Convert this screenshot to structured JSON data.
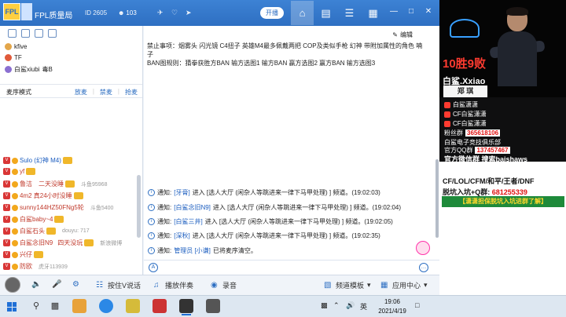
{
  "titlebar": {
    "logo_text": "FPL",
    "channel_name": "FPL质量局",
    "id_label": "ID 2605",
    "fans": "103",
    "open_label": "开播"
  },
  "left": {
    "rows": [
      {
        "name": "kfive"
      },
      {
        "name": "TF"
      },
      {
        "name": "白鲨xiubi",
        "tag": "毒B"
      }
    ],
    "queue_mode": "麦序模式",
    "queue_actions": [
      "放麦",
      "禁麦",
      "抢麦"
    ],
    "users": [
      {
        "name": "Sulo (幻神 M4)",
        "extra": ""
      },
      {
        "name": "yf",
        "extra": ""
      },
      {
        "name": "鲁洁",
        "name2": "二天没睡",
        "extra": "斗鱼95968"
      },
      {
        "name": "4m2 真24小时没睡",
        "extra": ""
      },
      {
        "name": "sunny144HZ50FNg5轮",
        "extra": "斗鱼5400"
      },
      {
        "name": "白鲨baby~4",
        "extra": ""
      },
      {
        "name": "白鲨石头",
        "extra": "douyu: 717"
      },
      {
        "name": "白鲨念旧N9",
        "name2": "四天没玩",
        "extra": "新浪微博"
      },
      {
        "name": "兴仔",
        "extra": ""
      },
      {
        "name": "防欧",
        "extra": "虎牙113939"
      }
    ]
  },
  "main": {
    "edit_label": "编辑",
    "notice": [
      "禁止事项：烟雾头 闪光镜 C4扭子 英雄M4最多佩戴两把 COP及类似手枪 幻神 带附加属性的角色 喃",
      "子",
      "BAN图规则：猜拳获胜方BAN 输方选图1 输方BAN 赢方选图2 赢方BAN 输方选图3"
    ],
    "messages": [
      {
        "prefix": "通知:",
        "channel": "[牙膏]",
        "text": " 进入 [选人大厅 (闲杂人等跳进来一律下马甲处理) ] 频道。(19:02:03)"
      },
      {
        "prefix": "通知:",
        "channel": "[白鲨念旧N9]",
        "text": " 进入 [选人大厅 (闲杂人等跳进来一律下马甲处理) ] 频道。(19:02:04)"
      },
      {
        "prefix": "通知:",
        "channel": "[白鲨三井]",
        "text": " 进入 [选人大厅 (闲杂人等跳进来一律下马甲处理) ] 频道。(19:02:05)"
      },
      {
        "prefix": "通知:",
        "channel": "[深秋]",
        "text": " 进入 [选人大厅 (闲杂人等跳进来一律下马甲处理) ] 频道。(19:02:35)"
      },
      {
        "prefix": "通知:",
        "channel": "管理员 [小谦]",
        "text": " 已将麦序清空。"
      }
    ]
  },
  "toolbar": {
    "voice_label": "按住V说话",
    "music_label": "播放伴奏",
    "record_label": "录音",
    "channel_template": "频道模板",
    "app_center": "应用中心"
  },
  "stream": {
    "score": "10胜9败",
    "player_name": "白鲨.Xxiao",
    "plate_name": "郑 琪",
    "lines": [
      {
        "label": "白鲨潇潇"
      },
      {
        "label": "CF白鲨潇潇"
      },
      {
        "label": "CF白鲨潇潇"
      }
    ],
    "fans_label": "粉丝群",
    "fans_value": "365618106",
    "club_label": "白鲨电子竞技俱乐部",
    "qq_group_label": "官方QQ群",
    "qq_group_value": "137457467",
    "wechat_label": "官方微信群 搜索baishaws",
    "games": "CF/LOL/CFM/和平/王者/DNF",
    "qq_line_label": "脱坑入坑+Q群:",
    "qq_line_value": "681255339",
    "guarantee": "【潇潇担保脱坑入坑进群了解】"
  },
  "taskbar": {
    "time": "19:06",
    "date": "2021/4/19",
    "ime": "英"
  }
}
